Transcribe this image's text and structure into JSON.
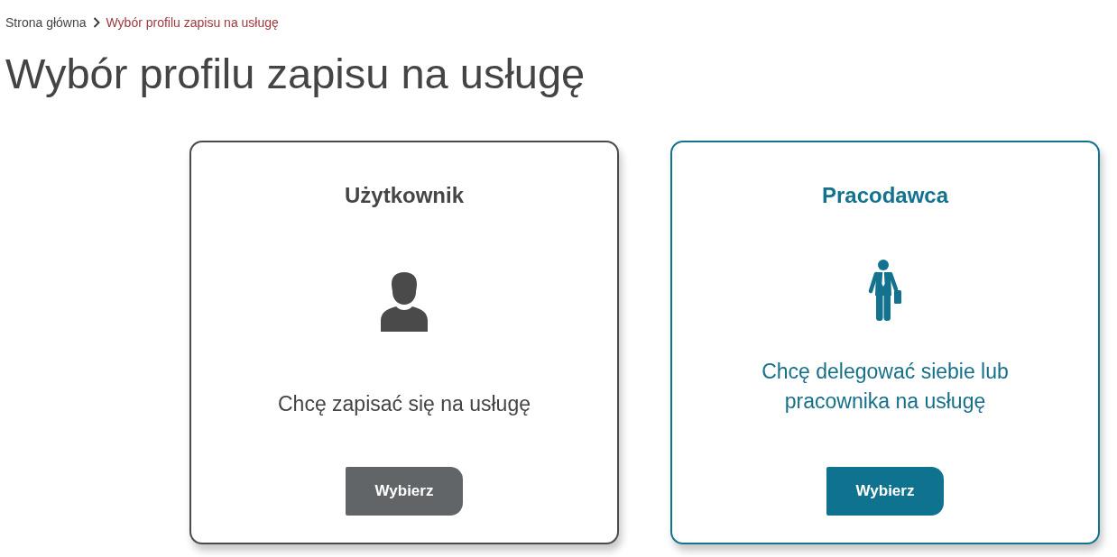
{
  "breadcrumb": [
    {
      "label": "Strona główna",
      "current": false
    },
    {
      "label": "Wybór profilu zapisu na usługę",
      "current": true
    }
  ],
  "page_title": "Wybór profilu zapisu na usługę",
  "profiles": [
    {
      "kind": "user",
      "title": "Użytkownik",
      "description": "Chcę zapisać się na usługę",
      "button": "Wybierz",
      "selected": false
    },
    {
      "kind": "employer",
      "title": "Pracodawca",
      "description": "Chcę delegować siebie lub pracownika na usługę",
      "button": "Wybierz",
      "selected": true
    }
  ]
}
